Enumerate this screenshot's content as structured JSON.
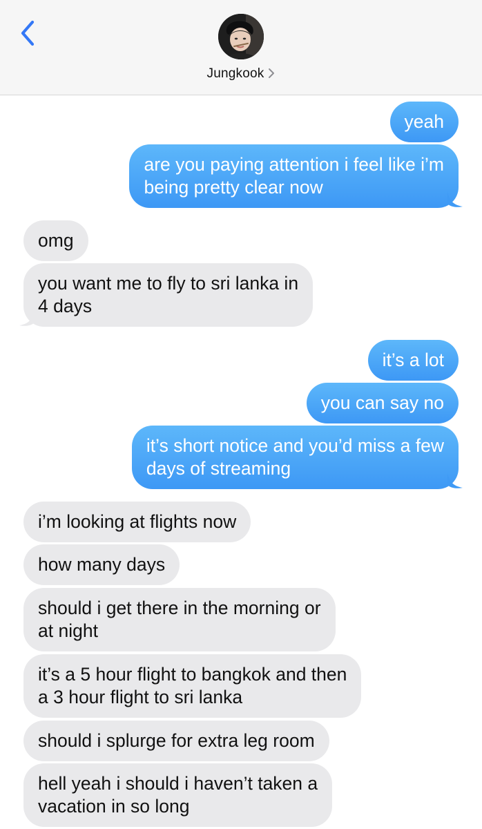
{
  "header": {
    "contact_name": "Jungkook",
    "back_icon": "chevron-left-icon",
    "detail_icon": "chevron-right-icon"
  },
  "colors": {
    "sent_bubble": "#4aa6f7",
    "received_bubble": "#e9e9eb",
    "accent": "#3478f6"
  },
  "messages": [
    {
      "from": "me",
      "text": "yeah"
    },
    {
      "from": "me",
      "lines": [
        "are you paying attention i feel like i’m",
        "being pretty clear now"
      ]
    },
    {
      "from": "them",
      "text": "omg"
    },
    {
      "from": "them",
      "lines": [
        "you want me to fly to sri lanka in",
        "4 days"
      ]
    },
    {
      "from": "me",
      "text": "it’s a lot"
    },
    {
      "from": "me",
      "text": "you can say no"
    },
    {
      "from": "me",
      "lines": [
        "it’s short notice and you’d miss a few",
        "days of streaming"
      ]
    },
    {
      "from": "them",
      "text": "i’m looking at flights now"
    },
    {
      "from": "them",
      "text": "how many days"
    },
    {
      "from": "them",
      "lines": [
        "should i get there in the morning or",
        "at night"
      ]
    },
    {
      "from": "them",
      "lines": [
        "it’s a 5 hour flight to bangkok and then",
        "a 3 hour flight to sri lanka"
      ]
    },
    {
      "from": "them",
      "text": "should i splurge for extra leg room"
    },
    {
      "from": "them",
      "lines": [
        "hell yeah i should i haven’t taken a",
        "vacation in so long"
      ]
    }
  ]
}
